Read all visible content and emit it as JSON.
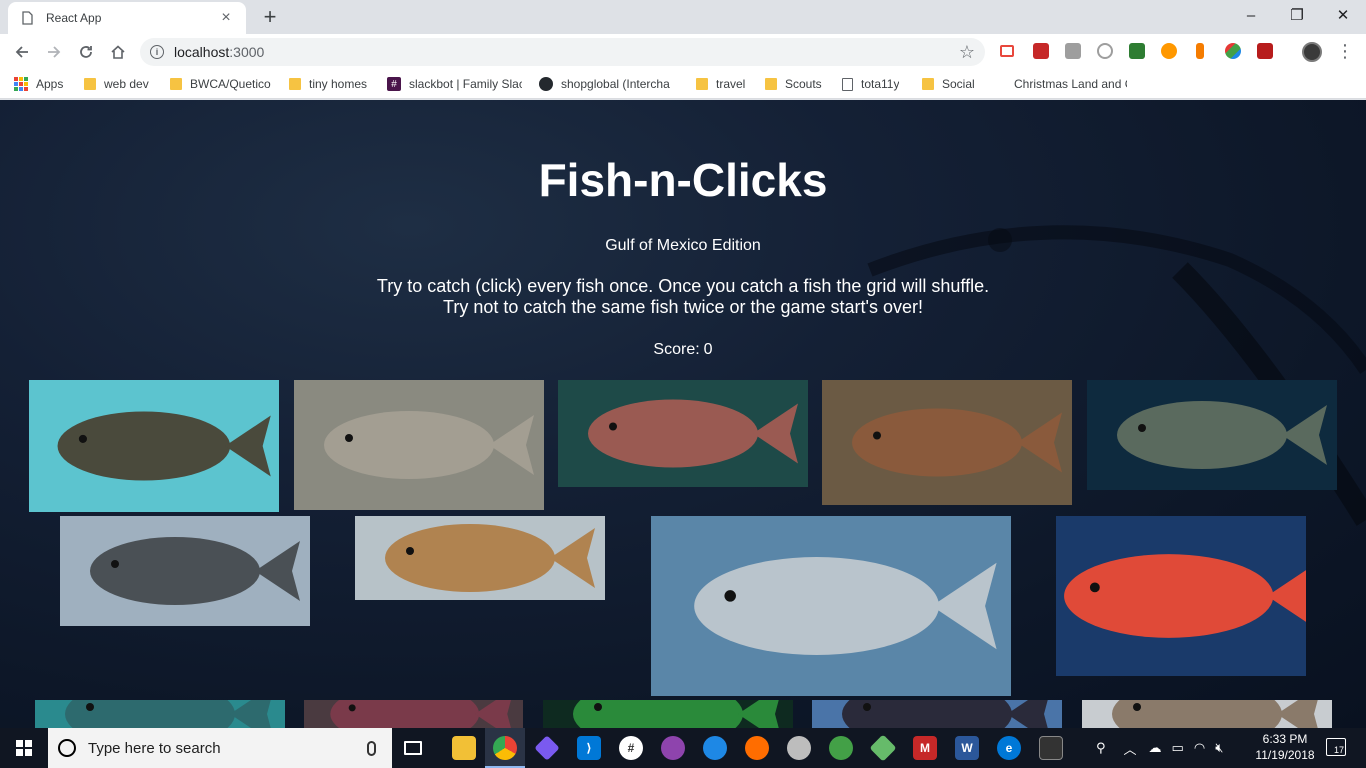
{
  "browser": {
    "tab_title": "React App",
    "new_tab_symbol": "+",
    "url_host": "localhost",
    "url_port": ":3000",
    "window_controls": {
      "minimize": "–",
      "restore": "❐",
      "close": "✕"
    }
  },
  "bookmarks": [
    {
      "label": "Apps",
      "icon": "apps-icon"
    },
    {
      "label": "web dev",
      "icon": "folder-icon"
    },
    {
      "label": "BWCA/Quetico",
      "icon": "folder-icon"
    },
    {
      "label": "tiny homes",
      "icon": "folder-icon"
    },
    {
      "label": "slackbot | Family Slac",
      "icon": "slack-icon"
    },
    {
      "label": "shopglobal (Intercha",
      "icon": "github-icon"
    },
    {
      "label": "travel",
      "icon": "folder-icon"
    },
    {
      "label": "Scouts",
      "icon": "folder-icon"
    },
    {
      "label": "tota11y",
      "icon": "page-icon"
    },
    {
      "label": "Social",
      "icon": "folder-icon"
    },
    {
      "label": "Christmas Land and C",
      "icon": "none"
    }
  ],
  "app": {
    "title": "Fish-n-Clicks",
    "subtitle": "Gulf of Mexico Edition",
    "instructions_line1": "Try to catch (click) every fish once. Once you catch a fish the grid will shuffle.",
    "instructions_line2": "Try not to catch the same fish twice or the game start's over!",
    "score_label": "Score:",
    "score_value": 0
  },
  "fish_cards": [
    {
      "name": "flounder",
      "bg": "#5cc4cf",
      "body": "#4a4a3c"
    },
    {
      "name": "southern-flounder",
      "bg": "#8a8a80",
      "body": "#a39e92"
    },
    {
      "name": "red-grouper",
      "bg": "#1e4a48",
      "body": "#9a5a52"
    },
    {
      "name": "scamp-grouper",
      "bg": "#6b5a44",
      "body": "#8a5a3c"
    },
    {
      "name": "black-grouper",
      "bg": "#0e2a3e",
      "body": "#5a6a5e"
    },
    {
      "name": "gag-grouper",
      "bg": "#9fb0bf",
      "body": "#4a5055"
    },
    {
      "name": "redfish",
      "bg": "#b7c2c8",
      "body": "#b08350"
    },
    {
      "name": "spanish-mackerel",
      "bg": "#5a86a8",
      "body": "#b9c4cc"
    },
    {
      "name": "queen-snapper",
      "bg": "#1a3a6a",
      "body": "#e04a38"
    },
    {
      "name": "reef-fish",
      "bg": "#2a8a8e",
      "body": "#2d6a6e"
    },
    {
      "name": "speckled-fish",
      "bg": "#4a3a40",
      "body": "#7a3a4a"
    },
    {
      "name": "green-fish",
      "bg": "#0e2a20",
      "body": "#2a8a3a"
    },
    {
      "name": "anglers",
      "bg": "#4a74a8",
      "body": "#2a2a3a"
    },
    {
      "name": "anglers-2",
      "bg": "#c8ccd0",
      "body": "#8a7a6a"
    }
  ],
  "taskbar": {
    "search_placeholder": "Type here to search",
    "time": "6:33 PM",
    "date": "11/19/2018",
    "notification_count": "17"
  }
}
